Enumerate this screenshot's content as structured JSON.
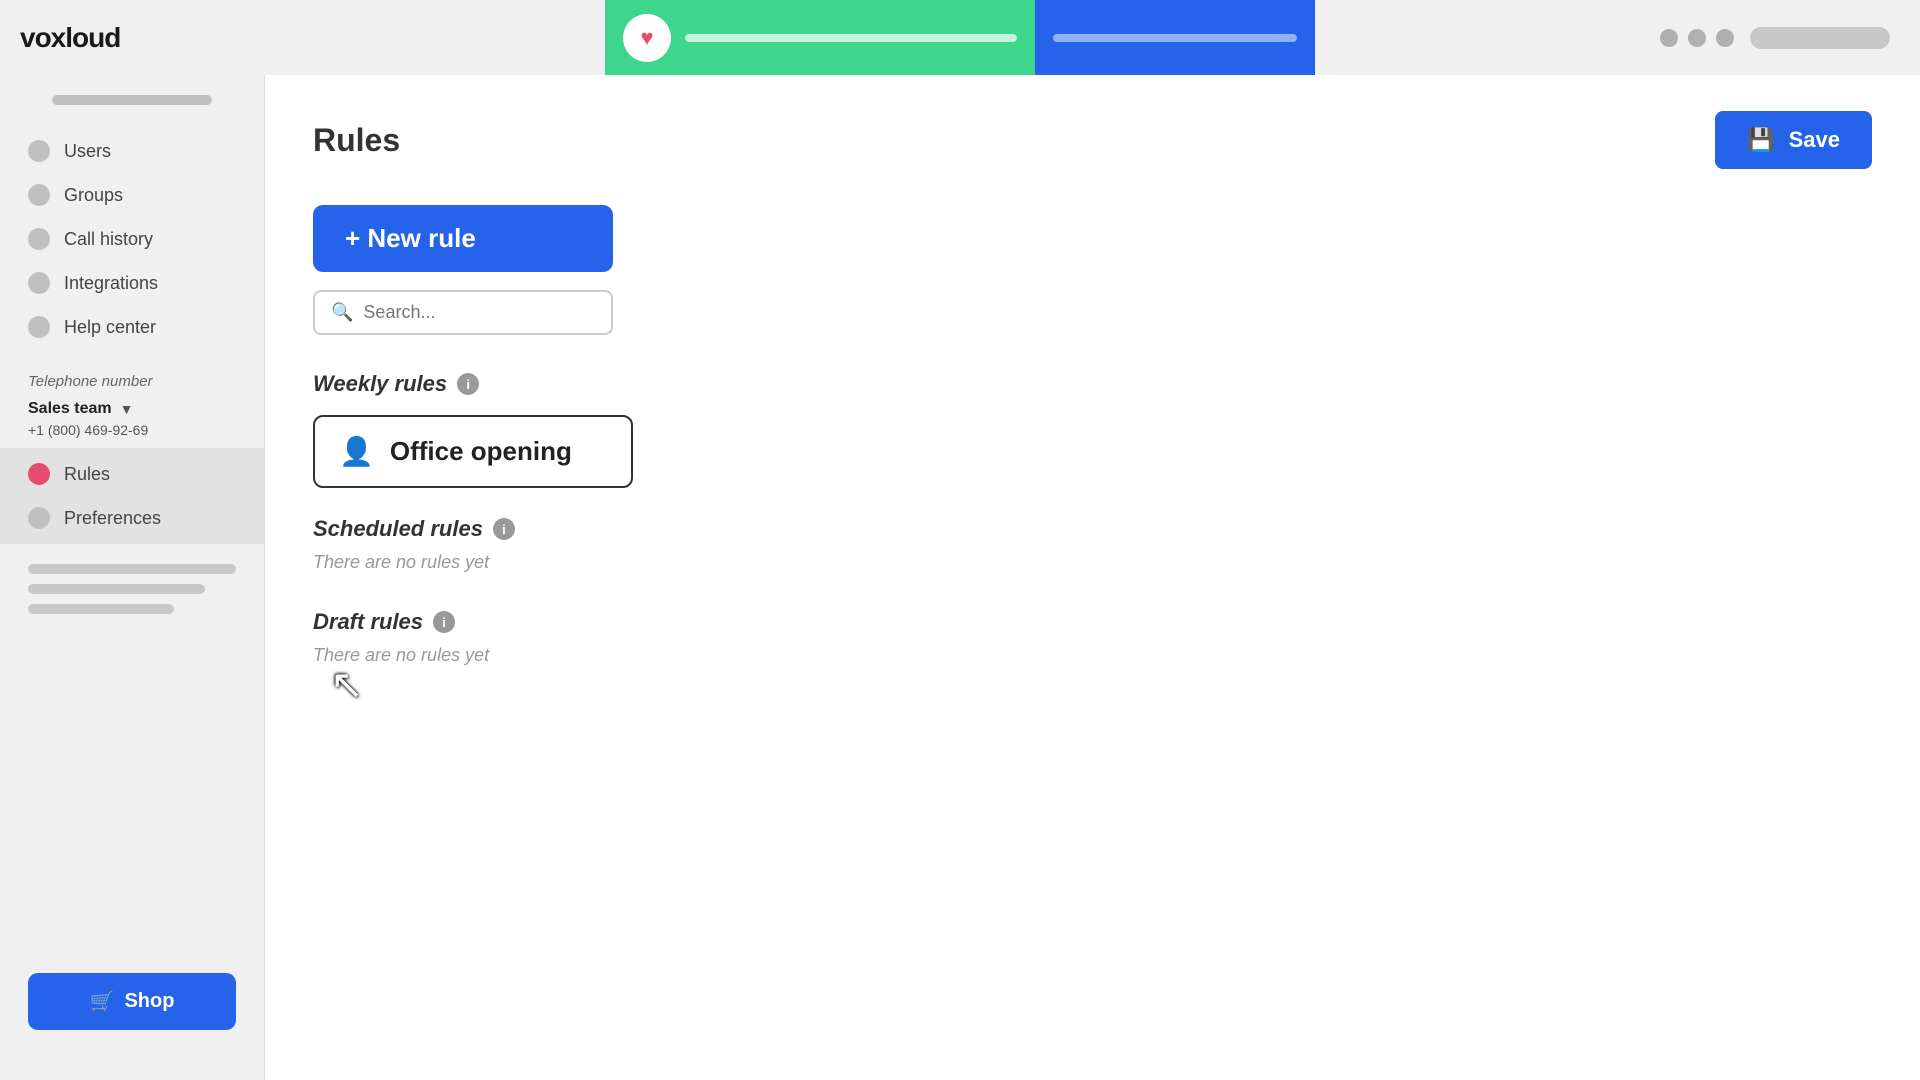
{
  "app": {
    "logo": "voxloud"
  },
  "header": {
    "dots": [
      "dot1",
      "dot2",
      "dot3"
    ]
  },
  "sidebar": {
    "nav_items": [
      {
        "id": "users",
        "label": "Users",
        "active": false
      },
      {
        "id": "groups",
        "label": "Groups",
        "active": false
      },
      {
        "id": "call-history",
        "label": "Call history",
        "active": false
      },
      {
        "id": "integrations",
        "label": "Integrations",
        "active": false
      },
      {
        "id": "help-center",
        "label": "Help center",
        "active": false
      }
    ],
    "telephone_label": "Telephone number",
    "team_name": "Sales team",
    "team_number": "+1 (800) 469-92-69",
    "active_items": [
      {
        "id": "rules",
        "label": "Rules"
      },
      {
        "id": "preferences",
        "label": "Preferences"
      }
    ],
    "shop_label": "Shop"
  },
  "main": {
    "page_title": "Rules",
    "save_button": "Save",
    "new_rule_button": "+ New rule",
    "search_placeholder": "Search...",
    "weekly_rules_heading": "Weekly rules",
    "weekly_rule_item": "Office opening",
    "scheduled_rules_heading": "Scheduled rules",
    "scheduled_no_rules": "There are no rules yet",
    "draft_rules_heading": "Draft rules",
    "draft_no_rules": "There are no rules yet"
  }
}
